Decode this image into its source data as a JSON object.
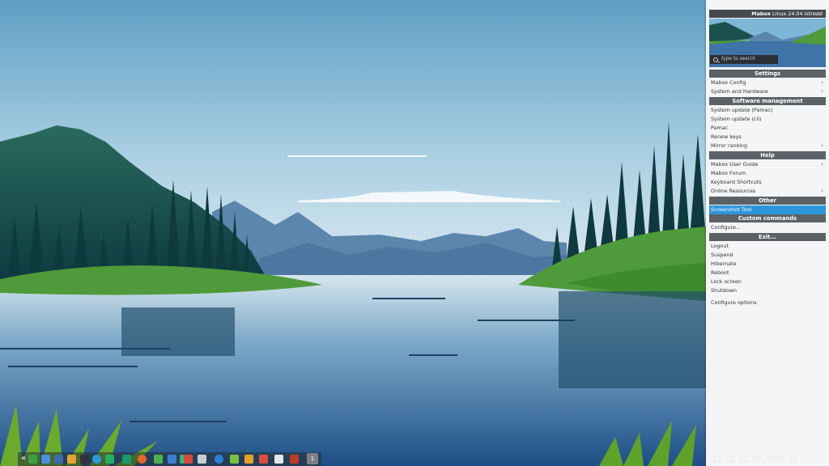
{
  "menu": {
    "title_bold": "Mabox",
    "title_rest": " Linux 24.04",
    "title_italic": "Istredd",
    "search_placeholder": "type to search",
    "sections": {
      "settings": "Settings",
      "software": "Software management",
      "help": "Help",
      "other": "Other",
      "custom": "Custom commands",
      "exit": "Exit..."
    },
    "settings_items": [
      "Mabox Config",
      "System and Hardware"
    ],
    "software_items": [
      "System update (Pamac)",
      "System update (cli)",
      "Pamac",
      "Renew keys",
      "Mirror ranking"
    ],
    "help_items": [
      "Mabox User Guide",
      "Mabox Forum",
      "Keyboard Shortcuts",
      "Online Resources"
    ],
    "other_items": [
      "Screenshot Tool"
    ],
    "custom_items": [
      "Configure..."
    ],
    "exit_items": [
      "Logout",
      "Suspend",
      "Hibernate",
      "Reboot",
      "Lock screen",
      "Shutdown"
    ],
    "footer_item": "Configure options",
    "submenu_arrow": "›",
    "highlight_color": "#2d95dc"
  },
  "taskbar": {
    "expand_glyph": "«",
    "workspace_label": "1",
    "apps": [
      "files-icon",
      "window-icon",
      "monitor-icon",
      "folder-icon",
      "terminal-icon",
      "globe-icon",
      "screenshot-icon",
      "store-icon",
      "firefox-icon",
      "doc-icon",
      "writer-icon",
      "calc-icon",
      "impress-icon",
      "paint-icon",
      "bottle-icon",
      "thunderbird-icon",
      "chat-icon",
      "image-icon",
      "video-icon",
      "red-app-icon",
      "text-editor-icon",
      "tool-icon"
    ]
  },
  "tray": {
    "clock": "10:46"
  }
}
